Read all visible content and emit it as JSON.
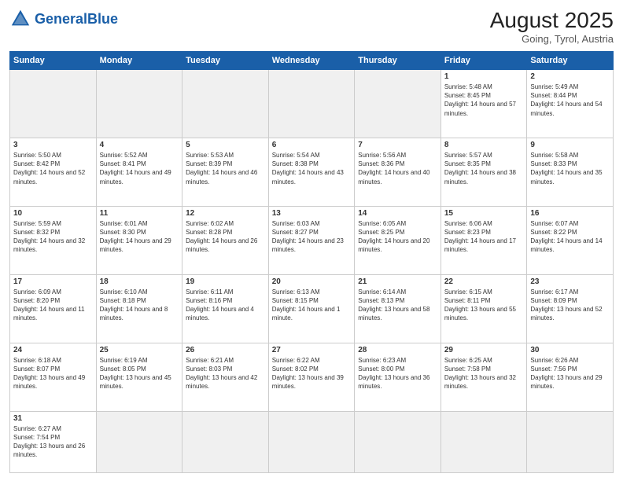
{
  "header": {
    "logo_general": "General",
    "logo_blue": "Blue",
    "month_year": "August 2025",
    "location": "Going, Tyrol, Austria"
  },
  "weekdays": [
    "Sunday",
    "Monday",
    "Tuesday",
    "Wednesday",
    "Thursday",
    "Friday",
    "Saturday"
  ],
  "weeks": [
    [
      {
        "day": "",
        "empty": true
      },
      {
        "day": "",
        "empty": true
      },
      {
        "day": "",
        "empty": true
      },
      {
        "day": "",
        "empty": true
      },
      {
        "day": "",
        "empty": true
      },
      {
        "day": "1",
        "sunrise": "5:48 AM",
        "sunset": "8:45 PM",
        "daylight": "14 hours and 57 minutes."
      },
      {
        "day": "2",
        "sunrise": "5:49 AM",
        "sunset": "8:44 PM",
        "daylight": "14 hours and 54 minutes."
      }
    ],
    [
      {
        "day": "3",
        "sunrise": "5:50 AM",
        "sunset": "8:42 PM",
        "daylight": "14 hours and 52 minutes."
      },
      {
        "day": "4",
        "sunrise": "5:52 AM",
        "sunset": "8:41 PM",
        "daylight": "14 hours and 49 minutes."
      },
      {
        "day": "5",
        "sunrise": "5:53 AM",
        "sunset": "8:39 PM",
        "daylight": "14 hours and 46 minutes."
      },
      {
        "day": "6",
        "sunrise": "5:54 AM",
        "sunset": "8:38 PM",
        "daylight": "14 hours and 43 minutes."
      },
      {
        "day": "7",
        "sunrise": "5:56 AM",
        "sunset": "8:36 PM",
        "daylight": "14 hours and 40 minutes."
      },
      {
        "day": "8",
        "sunrise": "5:57 AM",
        "sunset": "8:35 PM",
        "daylight": "14 hours and 38 minutes."
      },
      {
        "day": "9",
        "sunrise": "5:58 AM",
        "sunset": "8:33 PM",
        "daylight": "14 hours and 35 minutes."
      }
    ],
    [
      {
        "day": "10",
        "sunrise": "5:59 AM",
        "sunset": "8:32 PM",
        "daylight": "14 hours and 32 minutes."
      },
      {
        "day": "11",
        "sunrise": "6:01 AM",
        "sunset": "8:30 PM",
        "daylight": "14 hours and 29 minutes."
      },
      {
        "day": "12",
        "sunrise": "6:02 AM",
        "sunset": "8:28 PM",
        "daylight": "14 hours and 26 minutes."
      },
      {
        "day": "13",
        "sunrise": "6:03 AM",
        "sunset": "8:27 PM",
        "daylight": "14 hours and 23 minutes."
      },
      {
        "day": "14",
        "sunrise": "6:05 AM",
        "sunset": "8:25 PM",
        "daylight": "14 hours and 20 minutes."
      },
      {
        "day": "15",
        "sunrise": "6:06 AM",
        "sunset": "8:23 PM",
        "daylight": "14 hours and 17 minutes."
      },
      {
        "day": "16",
        "sunrise": "6:07 AM",
        "sunset": "8:22 PM",
        "daylight": "14 hours and 14 minutes."
      }
    ],
    [
      {
        "day": "17",
        "sunrise": "6:09 AM",
        "sunset": "8:20 PM",
        "daylight": "14 hours and 11 minutes."
      },
      {
        "day": "18",
        "sunrise": "6:10 AM",
        "sunset": "8:18 PM",
        "daylight": "14 hours and 8 minutes."
      },
      {
        "day": "19",
        "sunrise": "6:11 AM",
        "sunset": "8:16 PM",
        "daylight": "14 hours and 4 minutes."
      },
      {
        "day": "20",
        "sunrise": "6:13 AM",
        "sunset": "8:15 PM",
        "daylight": "14 hours and 1 minute."
      },
      {
        "day": "21",
        "sunrise": "6:14 AM",
        "sunset": "8:13 PM",
        "daylight": "13 hours and 58 minutes."
      },
      {
        "day": "22",
        "sunrise": "6:15 AM",
        "sunset": "8:11 PM",
        "daylight": "13 hours and 55 minutes."
      },
      {
        "day": "23",
        "sunrise": "6:17 AM",
        "sunset": "8:09 PM",
        "daylight": "13 hours and 52 minutes."
      }
    ],
    [
      {
        "day": "24",
        "sunrise": "6:18 AM",
        "sunset": "8:07 PM",
        "daylight": "13 hours and 49 minutes."
      },
      {
        "day": "25",
        "sunrise": "6:19 AM",
        "sunset": "8:05 PM",
        "daylight": "13 hours and 45 minutes."
      },
      {
        "day": "26",
        "sunrise": "6:21 AM",
        "sunset": "8:03 PM",
        "daylight": "13 hours and 42 minutes."
      },
      {
        "day": "27",
        "sunrise": "6:22 AM",
        "sunset": "8:02 PM",
        "daylight": "13 hours and 39 minutes."
      },
      {
        "day": "28",
        "sunrise": "6:23 AM",
        "sunset": "8:00 PM",
        "daylight": "13 hours and 36 minutes."
      },
      {
        "day": "29",
        "sunrise": "6:25 AM",
        "sunset": "7:58 PM",
        "daylight": "13 hours and 32 minutes."
      },
      {
        "day": "30",
        "sunrise": "6:26 AM",
        "sunset": "7:56 PM",
        "daylight": "13 hours and 29 minutes."
      }
    ],
    [
      {
        "day": "31",
        "sunrise": "6:27 AM",
        "sunset": "7:54 PM",
        "daylight": "13 hours and 26 minutes."
      },
      {
        "day": "",
        "empty": true
      },
      {
        "day": "",
        "empty": true
      },
      {
        "day": "",
        "empty": true
      },
      {
        "day": "",
        "empty": true
      },
      {
        "day": "",
        "empty": true
      },
      {
        "day": "",
        "empty": true
      }
    ]
  ]
}
